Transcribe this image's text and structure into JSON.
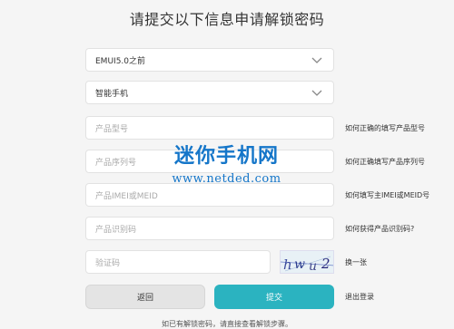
{
  "title": "请提交以下信息申请解锁密码",
  "emui_select": {
    "value": "EMUI5.0之前"
  },
  "device_select": {
    "value": "智能手机"
  },
  "fields": {
    "model": {
      "placeholder": "产品型号",
      "help": "如何正确的填写产品型号"
    },
    "serial": {
      "placeholder": "产品序列号",
      "help": "如何正确填写产品序列号"
    },
    "imei": {
      "placeholder": "产品IMEI或MEID",
      "help": "如何填写主IMEI或MEID号"
    },
    "product_id": {
      "placeholder": "产品识别码",
      "help": "如何获得产品识别码?"
    },
    "captcha": {
      "placeholder": "验证码",
      "refresh": "换一张",
      "image_text": "hwu2"
    }
  },
  "buttons": {
    "back": "返回",
    "submit": "提交",
    "logout": "退出登录"
  },
  "bottom_tip": "如已有解锁密码，请直接查看解锁步骤。",
  "watermark": {
    "title": "迷你手机网",
    "url": "www.netded.com"
  },
  "colors": {
    "accent": "#2bb3c0",
    "watermark": "#1576c9"
  },
  "icons": {
    "dropdown": "chevron-down-icon"
  }
}
